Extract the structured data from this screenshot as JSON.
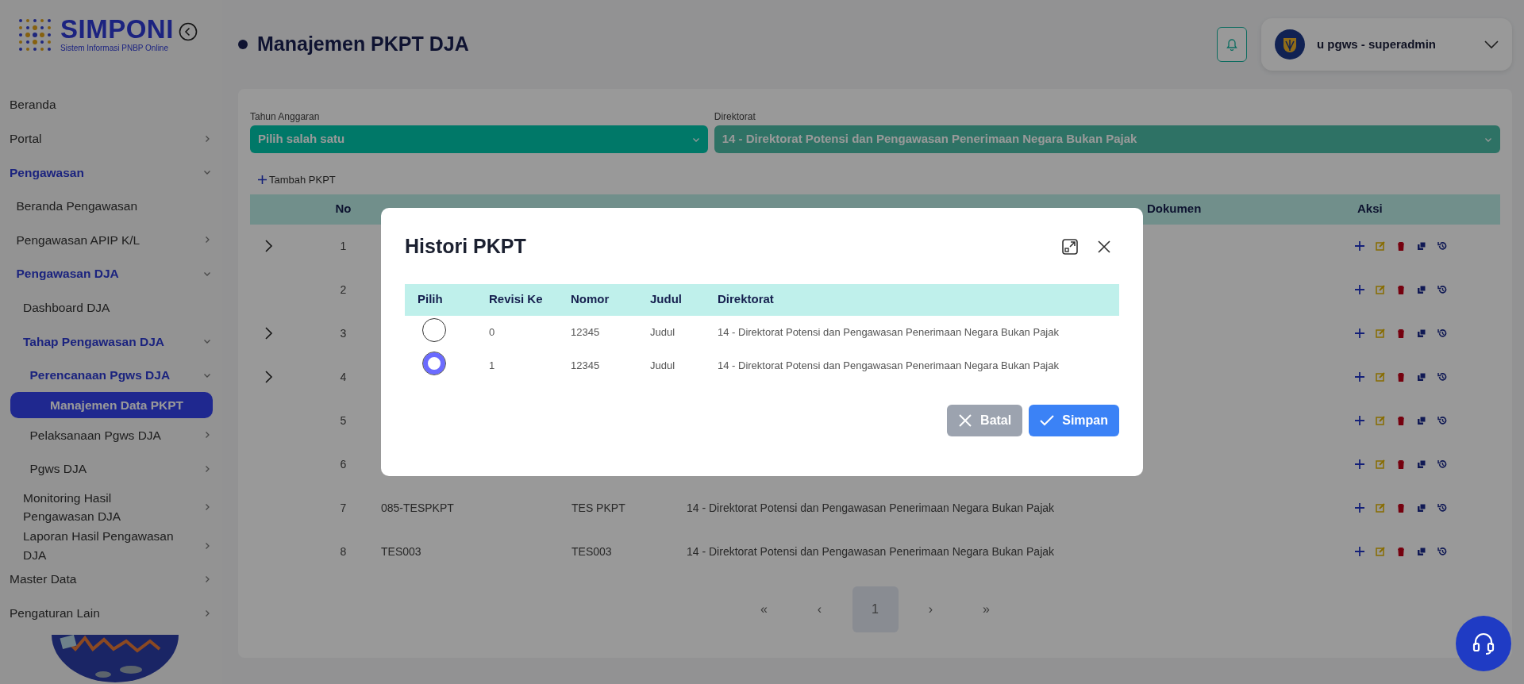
{
  "sidebar": {
    "logo_title": "SIMPONI",
    "logo_subtitle": "Sistem Informasi PNBP Online",
    "items": [
      {
        "label": "Beranda",
        "selected": false
      },
      {
        "label": "Portal",
        "selected": false,
        "expanded": false
      },
      {
        "label": "Pengawasan",
        "selected": false,
        "expanded": true,
        "children": [
          {
            "label": "Beranda Pengawasan",
            "selected": false
          },
          {
            "label": "Pengawasan APIP K/L",
            "selected": false,
            "expanded": false
          },
          {
            "label": "Pengawasan DJA",
            "selected": false,
            "expanded": true,
            "children": [
              {
                "label": "Dashboard DJA",
                "selected": false
              },
              {
                "label": "Tahap Pengawasan DJA",
                "selected": false,
                "expanded": true,
                "children": [
                  {
                    "label": "Perencanaan Pgws DJA",
                    "selected": false,
                    "expanded": true,
                    "children": [
                      {
                        "label": "Manajemen Data PKPT",
                        "selected": true
                      }
                    ]
                  },
                  {
                    "label": "Pelaksanaan Pgws DJA",
                    "selected": false,
                    "expanded": false
                  },
                  {
                    "label": "Pgws DJA",
                    "selected": false,
                    "expanded": false
                  }
                ]
              },
              {
                "label": "Monitoring Hasil Pengawasan DJA",
                "selected": false,
                "expanded": false
              },
              {
                "label": "Laporan Hasil Pengawasan DJA",
                "selected": false,
                "expanded": false
              }
            ]
          }
        ]
      },
      {
        "label": "Master Data",
        "selected": false,
        "expanded": false
      },
      {
        "label": "Pengaturan Lain",
        "selected": false,
        "expanded": false
      }
    ]
  },
  "header": {
    "page_title": "Manajemen PKPT DJA",
    "user": "u pgws - superadmin"
  },
  "filters": [
    {
      "label": "Tahun Anggaran",
      "value": "Pilih salah satu",
      "focused": true
    },
    {
      "label": "Direktorat",
      "value": "14 - Direktorat Potensi dan Pengawasan Penerimaan Negara Bukan Pajak",
      "focused": false
    }
  ],
  "add_button": "Tambah PKPT",
  "table": {
    "columns": [
      "No",
      "Dokumen",
      "Aksi"
    ],
    "rows": [
      {
        "no": "1",
        "expandable": true
      },
      {
        "no": "2",
        "expandable": false
      },
      {
        "no": "3",
        "expandable": true
      },
      {
        "no": "4",
        "expandable": true
      },
      {
        "no": "5",
        "expandable": false
      },
      {
        "no": "6",
        "expandable": false
      },
      {
        "no": "7",
        "expandable": false,
        "nomor": "085-TESPKPT",
        "judul": "TES PKPT",
        "direktorat": "14 - Direktorat Potensi dan Pengawasan Penerimaan Negara Bukan Pajak"
      },
      {
        "no": "8",
        "expandable": false,
        "nomor": "TES003",
        "judul": "TES003",
        "direktorat": "14 - Direktorat Potensi dan Pengawasan Penerimaan Negara Bukan Pajak"
      }
    ]
  },
  "pagination": [
    {
      "label": "«",
      "selected": false
    },
    {
      "label": "‹",
      "selected": false
    },
    {
      "label": "1",
      "selected": true
    },
    {
      "label": "›",
      "selected": false
    },
    {
      "label": "»",
      "selected": false
    }
  ],
  "modal": {
    "title": "Histori PKPT",
    "columns": [
      "Pilih",
      "Revisi Ke",
      "Nomor",
      "Judul",
      "Direktorat"
    ],
    "rows": [
      {
        "selected": false,
        "revisi": "0",
        "nomor": "12345",
        "judul": "Judul",
        "direktorat": "14 - Direktorat Potensi dan Pengawasan Penerimaan Negara Bukan Pajak"
      },
      {
        "selected": true,
        "revisi": "1",
        "nomor": "12345",
        "judul": "Judul",
        "direktorat": "14 - Direktorat Potensi dan Pengawasan Penerimaan Negara Bukan Pajak"
      }
    ],
    "buttons": [
      {
        "label": "Batal",
        "kind": "cancel"
      },
      {
        "label": "Simpan",
        "kind": "primary"
      }
    ]
  }
}
